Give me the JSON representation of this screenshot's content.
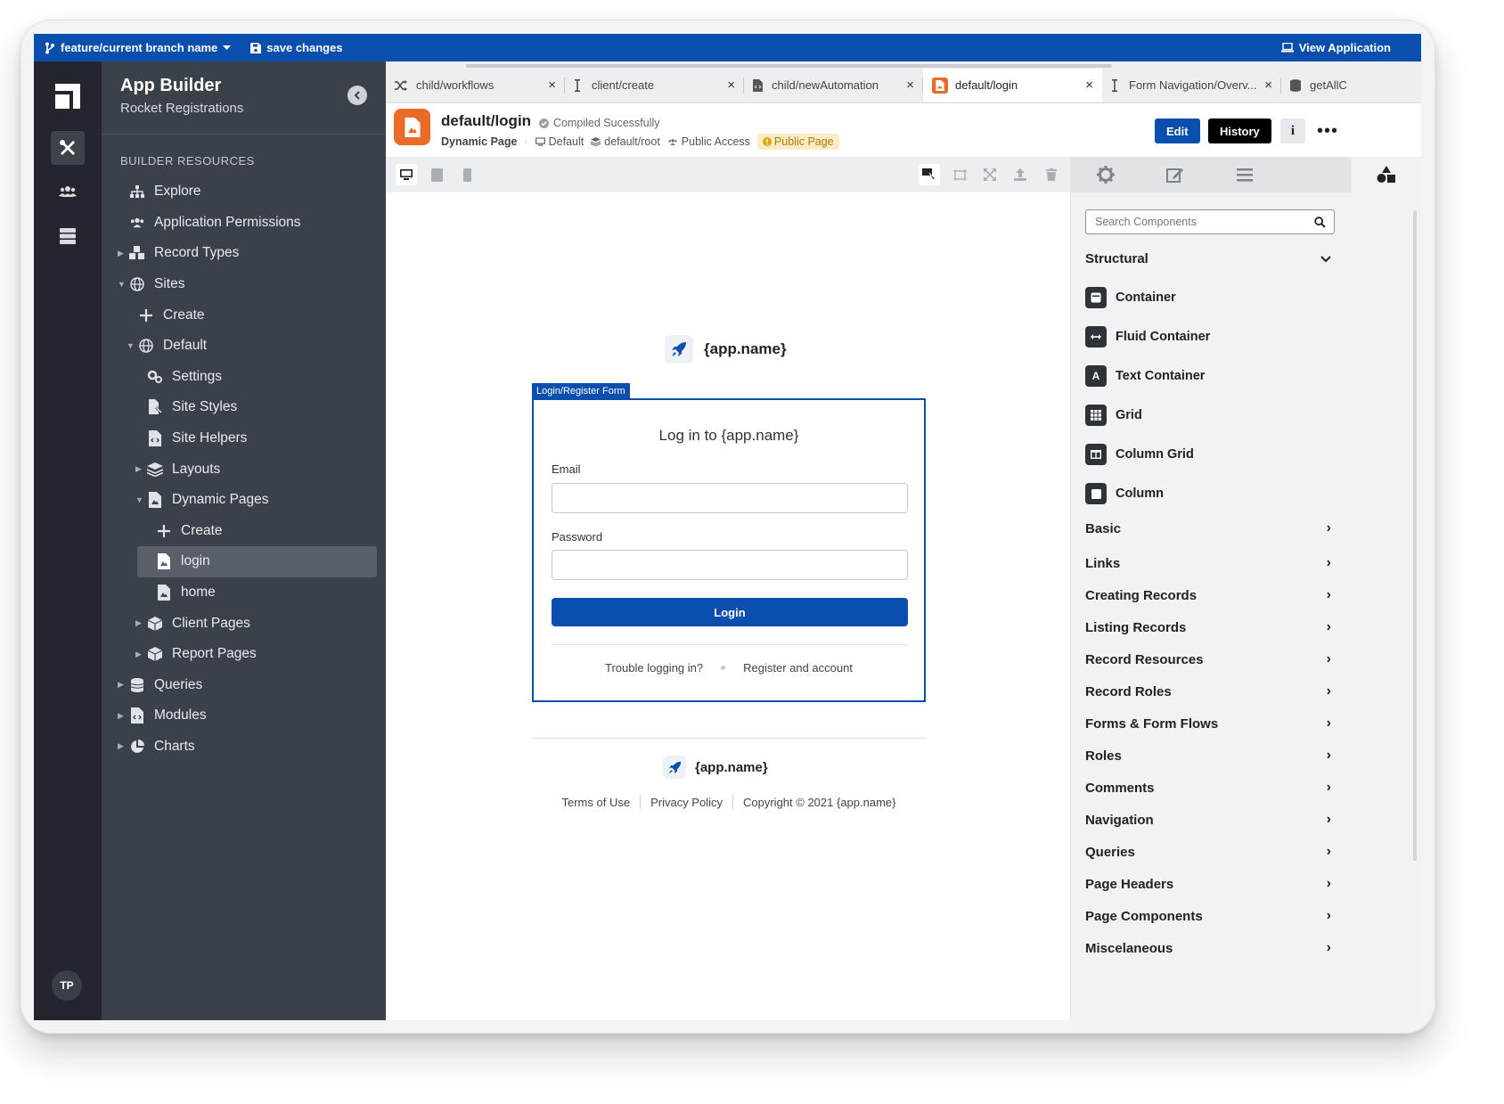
{
  "topbar": {
    "branch": "feature/current branch name",
    "save": "save changes",
    "view_app": "View Application"
  },
  "rail": {
    "avatar": "TP"
  },
  "sidebar": {
    "title": "App Builder",
    "subtitle": "Rocket Registrations",
    "section": "BUILDER RESOURCES",
    "items": [
      {
        "label": "Explore"
      },
      {
        "label": "Application Permissions"
      },
      {
        "label": "Record Types"
      },
      {
        "label": "Sites"
      },
      {
        "label": "Create"
      },
      {
        "label": "Default"
      },
      {
        "label": "Settings"
      },
      {
        "label": "Site Styles"
      },
      {
        "label": "Site Helpers"
      },
      {
        "label": "Layouts"
      },
      {
        "label": "Dynamic Pages"
      },
      {
        "label": "Create"
      },
      {
        "label": "login"
      },
      {
        "label": "home"
      },
      {
        "label": "Client Pages"
      },
      {
        "label": "Report Pages"
      },
      {
        "label": "Queries"
      },
      {
        "label": "Modules"
      },
      {
        "label": "Charts"
      }
    ]
  },
  "tabs": [
    {
      "label": "child/workflows"
    },
    {
      "label": "client/create"
    },
    {
      "label": "child/newAutomation"
    },
    {
      "label": "default/login"
    },
    {
      "label": "Form Navigation/Overv..."
    },
    {
      "label": "getAllC"
    }
  ],
  "page": {
    "title": "default/login",
    "status": "Compiled Sucessfully",
    "type": "Dynamic Page",
    "layout": "Default",
    "root": "default/root",
    "access": "Public Access",
    "badge": "Public Page",
    "edit": "Edit",
    "history": "History",
    "info": "i",
    "more": "•••"
  },
  "canvas": {
    "app_name": "{app.name}",
    "form_label": "Login/Register Form",
    "form_title": "Log in to {app.name}",
    "email_label": "Email",
    "password_label": "Password",
    "login_button": "Login",
    "trouble": "Trouble logging in?",
    "register": "Register and account",
    "footer_app_name": "{app.name}",
    "terms": "Terms of Use",
    "privacy": "Privacy Policy",
    "copyright": "Copyright © 2021 {app.name}"
  },
  "rpanel": {
    "search_placeholder": "Search Components",
    "structural": "Structural",
    "components": [
      {
        "label": "Container",
        "icon": "container-icon"
      },
      {
        "label": "Fluid Container",
        "icon": "fluid-icon"
      },
      {
        "label": "Text Container",
        "icon": "text-icon"
      },
      {
        "label": "Grid",
        "icon": "grid-icon"
      },
      {
        "label": "Column Grid",
        "icon": "column-grid-icon"
      },
      {
        "label": "Column",
        "icon": "column-icon"
      }
    ],
    "categories": [
      {
        "label": "Basic"
      },
      {
        "label": "Links"
      },
      {
        "label": "Creating Records"
      },
      {
        "label": "Listing Records"
      },
      {
        "label": "Record Resources"
      },
      {
        "label": "Record Roles"
      },
      {
        "label": "Forms & Form Flows"
      },
      {
        "label": "Roles"
      },
      {
        "label": "Comments"
      },
      {
        "label": "Navigation"
      },
      {
        "label": "Queries"
      },
      {
        "label": "Page Headers"
      },
      {
        "label": "Page Components"
      },
      {
        "label": "Miscelaneous"
      }
    ]
  },
  "colors": {
    "accent": "#0b4fae",
    "sidebar": "#3b4149",
    "rail": "#23272d",
    "page_icon": "#ea6a27"
  }
}
